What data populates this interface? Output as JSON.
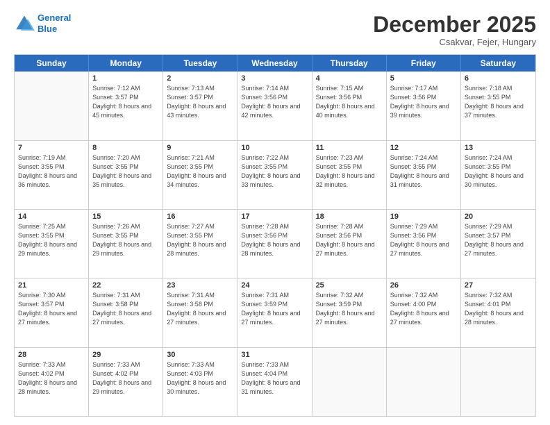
{
  "logo": {
    "line1": "General",
    "line2": "Blue"
  },
  "header": {
    "month": "December 2025",
    "location": "Csakvar, Fejer, Hungary"
  },
  "days": [
    "Sunday",
    "Monday",
    "Tuesday",
    "Wednesday",
    "Thursday",
    "Friday",
    "Saturday"
  ],
  "weeks": [
    [
      {
        "num": "",
        "empty": true
      },
      {
        "num": "1",
        "rise": "7:12 AM",
        "set": "3:57 PM",
        "daylight": "8 hours and 45 minutes."
      },
      {
        "num": "2",
        "rise": "7:13 AM",
        "set": "3:57 PM",
        "daylight": "8 hours and 43 minutes."
      },
      {
        "num": "3",
        "rise": "7:14 AM",
        "set": "3:56 PM",
        "daylight": "8 hours and 42 minutes."
      },
      {
        "num": "4",
        "rise": "7:15 AM",
        "set": "3:56 PM",
        "daylight": "8 hours and 40 minutes."
      },
      {
        "num": "5",
        "rise": "7:17 AM",
        "set": "3:56 PM",
        "daylight": "8 hours and 39 minutes."
      },
      {
        "num": "6",
        "rise": "7:18 AM",
        "set": "3:55 PM",
        "daylight": "8 hours and 37 minutes."
      }
    ],
    [
      {
        "num": "7",
        "rise": "7:19 AM",
        "set": "3:55 PM",
        "daylight": "8 hours and 36 minutes."
      },
      {
        "num": "8",
        "rise": "7:20 AM",
        "set": "3:55 PM",
        "daylight": "8 hours and 35 minutes."
      },
      {
        "num": "9",
        "rise": "7:21 AM",
        "set": "3:55 PM",
        "daylight": "8 hours and 34 minutes."
      },
      {
        "num": "10",
        "rise": "7:22 AM",
        "set": "3:55 PM",
        "daylight": "8 hours and 33 minutes."
      },
      {
        "num": "11",
        "rise": "7:23 AM",
        "set": "3:55 PM",
        "daylight": "8 hours and 32 minutes."
      },
      {
        "num": "12",
        "rise": "7:24 AM",
        "set": "3:55 PM",
        "daylight": "8 hours and 31 minutes."
      },
      {
        "num": "13",
        "rise": "7:24 AM",
        "set": "3:55 PM",
        "daylight": "8 hours and 30 minutes."
      }
    ],
    [
      {
        "num": "14",
        "rise": "7:25 AM",
        "set": "3:55 PM",
        "daylight": "8 hours and 29 minutes."
      },
      {
        "num": "15",
        "rise": "7:26 AM",
        "set": "3:55 PM",
        "daylight": "8 hours and 29 minutes."
      },
      {
        "num": "16",
        "rise": "7:27 AM",
        "set": "3:55 PM",
        "daylight": "8 hours and 28 minutes."
      },
      {
        "num": "17",
        "rise": "7:28 AM",
        "set": "3:56 PM",
        "daylight": "8 hours and 28 minutes."
      },
      {
        "num": "18",
        "rise": "7:28 AM",
        "set": "3:56 PM",
        "daylight": "8 hours and 27 minutes."
      },
      {
        "num": "19",
        "rise": "7:29 AM",
        "set": "3:56 PM",
        "daylight": "8 hours and 27 minutes."
      },
      {
        "num": "20",
        "rise": "7:29 AM",
        "set": "3:57 PM",
        "daylight": "8 hours and 27 minutes."
      }
    ],
    [
      {
        "num": "21",
        "rise": "7:30 AM",
        "set": "3:57 PM",
        "daylight": "8 hours and 27 minutes."
      },
      {
        "num": "22",
        "rise": "7:31 AM",
        "set": "3:58 PM",
        "daylight": "8 hours and 27 minutes."
      },
      {
        "num": "23",
        "rise": "7:31 AM",
        "set": "3:58 PM",
        "daylight": "8 hours and 27 minutes."
      },
      {
        "num": "24",
        "rise": "7:31 AM",
        "set": "3:59 PM",
        "daylight": "8 hours and 27 minutes."
      },
      {
        "num": "25",
        "rise": "7:32 AM",
        "set": "3:59 PM",
        "daylight": "8 hours and 27 minutes."
      },
      {
        "num": "26",
        "rise": "7:32 AM",
        "set": "4:00 PM",
        "daylight": "8 hours and 27 minutes."
      },
      {
        "num": "27",
        "rise": "7:32 AM",
        "set": "4:01 PM",
        "daylight": "8 hours and 28 minutes."
      }
    ],
    [
      {
        "num": "28",
        "rise": "7:33 AM",
        "set": "4:02 PM",
        "daylight": "8 hours and 28 minutes."
      },
      {
        "num": "29",
        "rise": "7:33 AM",
        "set": "4:02 PM",
        "daylight": "8 hours and 29 minutes."
      },
      {
        "num": "30",
        "rise": "7:33 AM",
        "set": "4:03 PM",
        "daylight": "8 hours and 30 minutes."
      },
      {
        "num": "31",
        "rise": "7:33 AM",
        "set": "4:04 PM",
        "daylight": "8 hours and 31 minutes."
      },
      {
        "num": "",
        "empty": true
      },
      {
        "num": "",
        "empty": true
      },
      {
        "num": "",
        "empty": true
      }
    ]
  ],
  "labels": {
    "sunrise": "Sunrise:",
    "sunset": "Sunset:",
    "daylight": "Daylight:"
  }
}
